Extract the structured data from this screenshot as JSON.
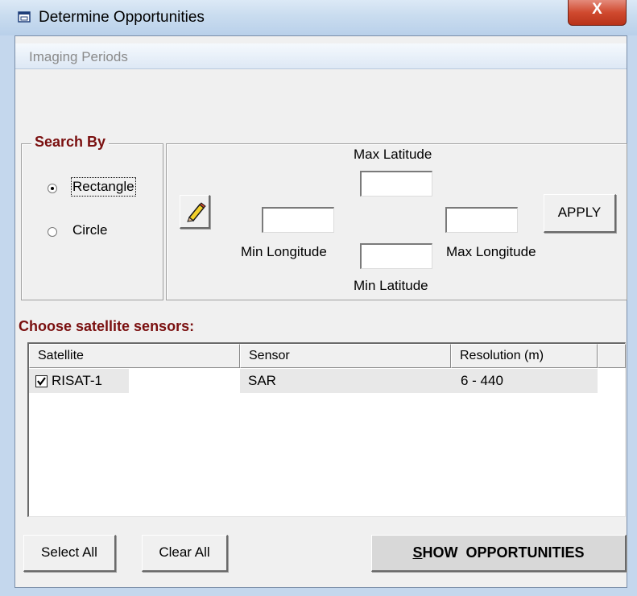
{
  "window": {
    "title": "Determine Opportunities",
    "close_label": "X"
  },
  "menu": {
    "items": [
      {
        "label": "Imaging Periods"
      }
    ]
  },
  "search_by": {
    "title": "Search By",
    "options": [
      {
        "label": "Rectangle",
        "selected": true
      },
      {
        "label": "Circle",
        "selected": false
      }
    ]
  },
  "coords": {
    "max_latitude_label": "Max Latitude",
    "min_longitude_label": "Min Longitude",
    "max_longitude_label": "Max Longitude",
    "min_latitude_label": "Min Latitude",
    "max_latitude_value": "",
    "min_longitude_value": "",
    "max_longitude_value": "",
    "min_latitude_value": "",
    "draw_icon": "pencil-icon",
    "apply_label": "APPLY"
  },
  "sensors": {
    "label": "Choose satellite sensors:",
    "columns": [
      "Satellite",
      "Sensor",
      "Resolution (m)"
    ],
    "rows": [
      {
        "checked": true,
        "satellite": "RISAT-1",
        "sensor": "SAR",
        "resolution": "6 - 440"
      }
    ]
  },
  "actions": {
    "select_all": "Select All",
    "clear_all": "Clear All",
    "show_opportunities_prefix": "S",
    "show_opportunities_rest": "HOW  OPPORTUNITIES"
  },
  "colors": {
    "section_title": "#7a0f0f",
    "close_button": "#d04a2f"
  }
}
